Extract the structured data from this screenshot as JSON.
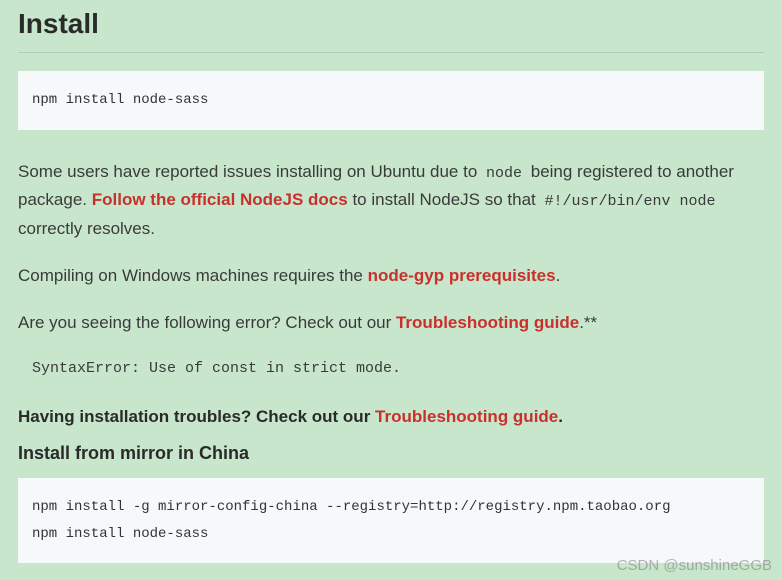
{
  "heading": "Install",
  "code1": "npm install node-sass",
  "para1": {
    "t1": "Some users have reported issues installing on Ubuntu due to ",
    "code1": "node",
    "t2": " being registered to another package. ",
    "link": "Follow the official NodeJS docs",
    "t3": " to install NodeJS so that ",
    "code2": "#!/usr/bin/env node",
    "t4": " correctly resolves."
  },
  "para2": {
    "t1": "Compiling on Windows machines requires the ",
    "link": "node-gyp prerequisites",
    "t2": "."
  },
  "para3": {
    "t1": "Are you seeing the following error? Check out our ",
    "link": "Troubleshooting guide",
    "t2": ".**"
  },
  "error_text": "SyntaxError: Use of const in strict mode.",
  "para4": {
    "t1": "Having installation troubles? Check out our ",
    "link": "Troubleshooting guide",
    "t2": "."
  },
  "subheading": "Install from mirror in China",
  "code2": "npm install -g mirror-config-china --registry=http://registry.npm.taobao.org\nnpm install node-sass",
  "watermark": "CSDN @sunshineGGB"
}
